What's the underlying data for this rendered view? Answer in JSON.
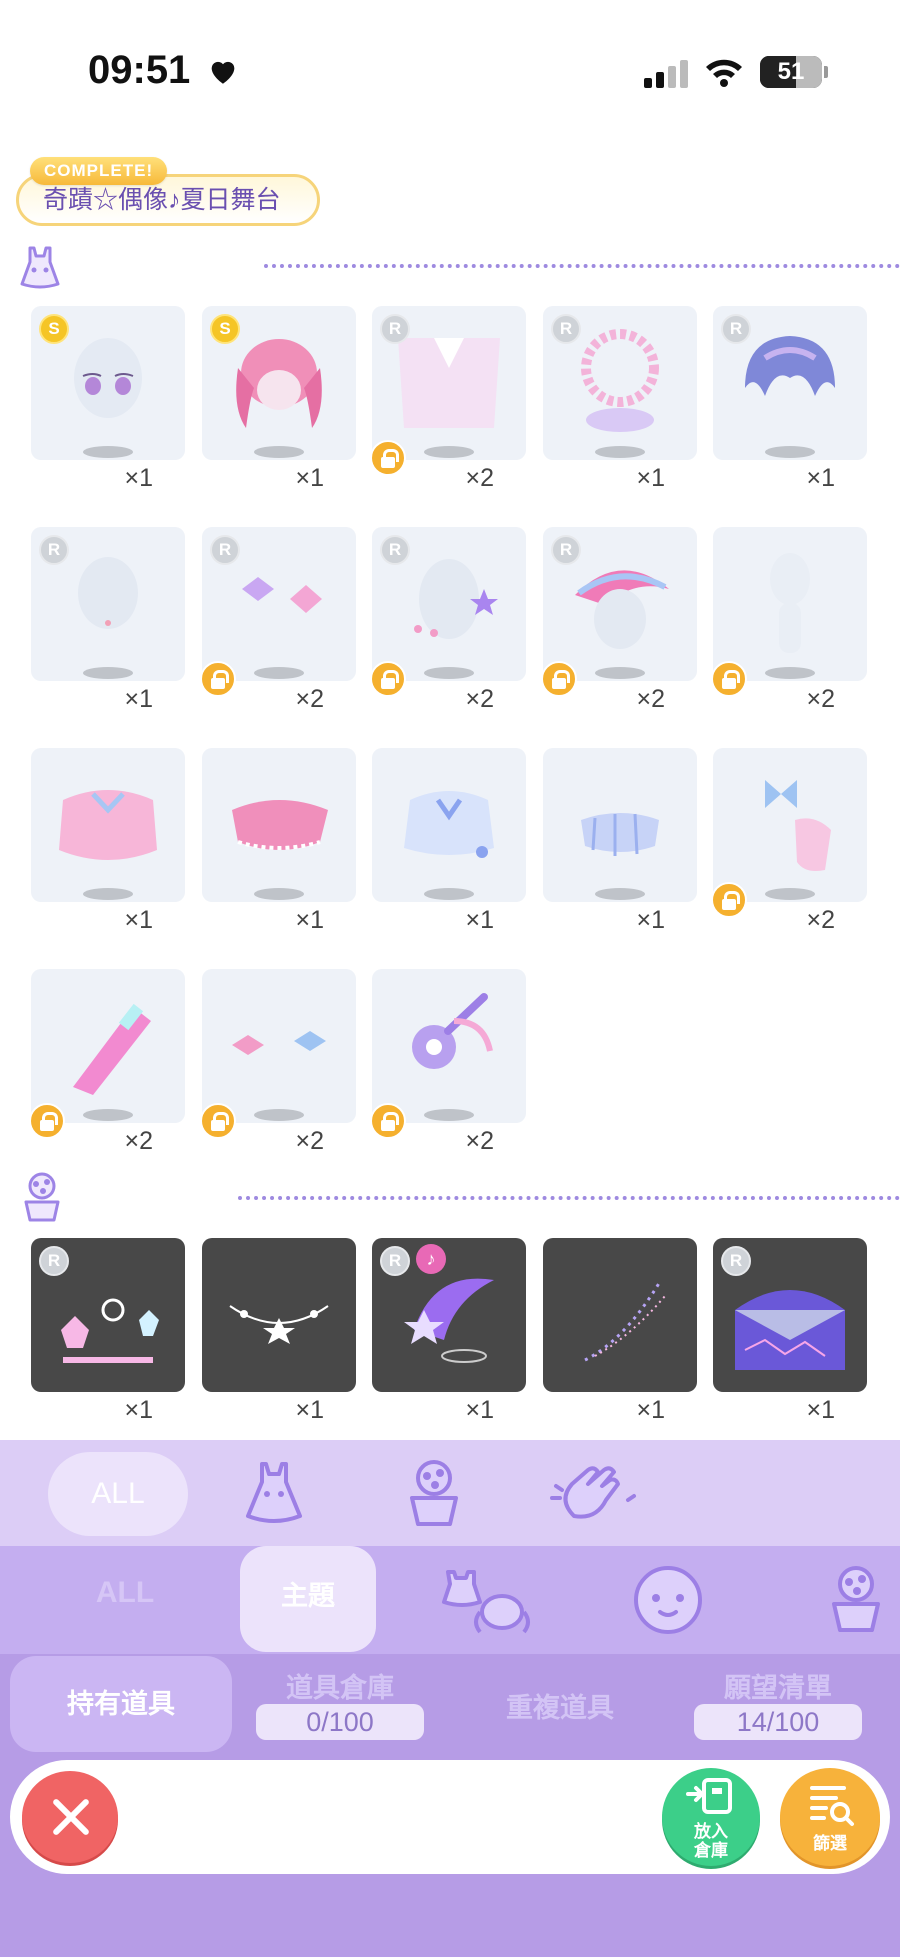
{
  "status_bar": {
    "time": "09:51",
    "battery": "51"
  },
  "theme": {
    "complete_label": "COMPLETE!",
    "title": "奇蹟☆偶像♪夏日舞台"
  },
  "items": [
    {
      "badge": "S",
      "qty": "×1",
      "locked": false,
      "art": "eyes"
    },
    {
      "badge": "S",
      "qty": "×1",
      "locked": false,
      "art": "pink-hair"
    },
    {
      "badge": "R",
      "qty": "×2",
      "locked": true,
      "art": "backdrop"
    },
    {
      "badge": "R",
      "qty": "×1",
      "locked": false,
      "art": "wreath"
    },
    {
      "badge": "R",
      "qty": "×1",
      "locked": false,
      "art": "blue-hair"
    },
    {
      "badge": "R",
      "qty": "×1",
      "locked": false,
      "art": "blank"
    },
    {
      "badge": "R",
      "qty": "×2",
      "locked": true,
      "art": "bows"
    },
    {
      "badge": "R",
      "qty": "×2",
      "locked": true,
      "art": "star-earring"
    },
    {
      "badge": "R",
      "qty": "×2",
      "locked": true,
      "art": "visor"
    },
    {
      "badge": "",
      "qty": "×2",
      "locked": true,
      "art": "body"
    },
    {
      "badge": "",
      "qty": "×1",
      "locked": false,
      "art": "pink-top"
    },
    {
      "badge": "",
      "qty": "×1",
      "locked": false,
      "art": "skirt"
    },
    {
      "badge": "",
      "qty": "×1",
      "locked": false,
      "art": "blue-top"
    },
    {
      "badge": "",
      "qty": "×1",
      "locked": false,
      "art": "plaid-skirt"
    },
    {
      "badge": "",
      "qty": "×2",
      "locked": true,
      "art": "ribbon-socks"
    },
    {
      "badge": "",
      "qty": "×2",
      "locked": true,
      "art": "pink-gun"
    },
    {
      "badge": "",
      "qty": "×2",
      "locked": true,
      "art": "hair-bows"
    },
    {
      "badge": "",
      "qty": "×2",
      "locked": true,
      "art": "fan"
    }
  ],
  "effects": [
    {
      "badge": "R",
      "qty": "×1",
      "music": false,
      "art": "lightsticks"
    },
    {
      "badge": "",
      "qty": "×1",
      "music": false,
      "art": "star-chain"
    },
    {
      "badge": "R",
      "qty": "×1",
      "music": true,
      "art": "star-swirl"
    },
    {
      "badge": "",
      "qty": "×1",
      "music": false,
      "art": "sparkle-trail"
    },
    {
      "badge": "R",
      "qty": "×1",
      "music": false,
      "art": "stage-floor"
    }
  ],
  "category_tabs": {
    "all": "ALL"
  },
  "sub_tabs": {
    "all": "ALL",
    "theme": "主題"
  },
  "bottom_tabs": {
    "owned": "持有道具",
    "storage": "道具倉庫",
    "storage_count": "0/100",
    "duplicate": "重複道具",
    "wishlist": "願望清單",
    "wishlist_count": "14/100"
  },
  "actions": {
    "store": "放入\n倉庫",
    "filter": "篩選"
  },
  "colors": {
    "accent": "#b69ce6",
    "lock": "#f5b02e",
    "close": "#f06464",
    "store": "#3ccf89",
    "filter": "#f7b23b"
  }
}
